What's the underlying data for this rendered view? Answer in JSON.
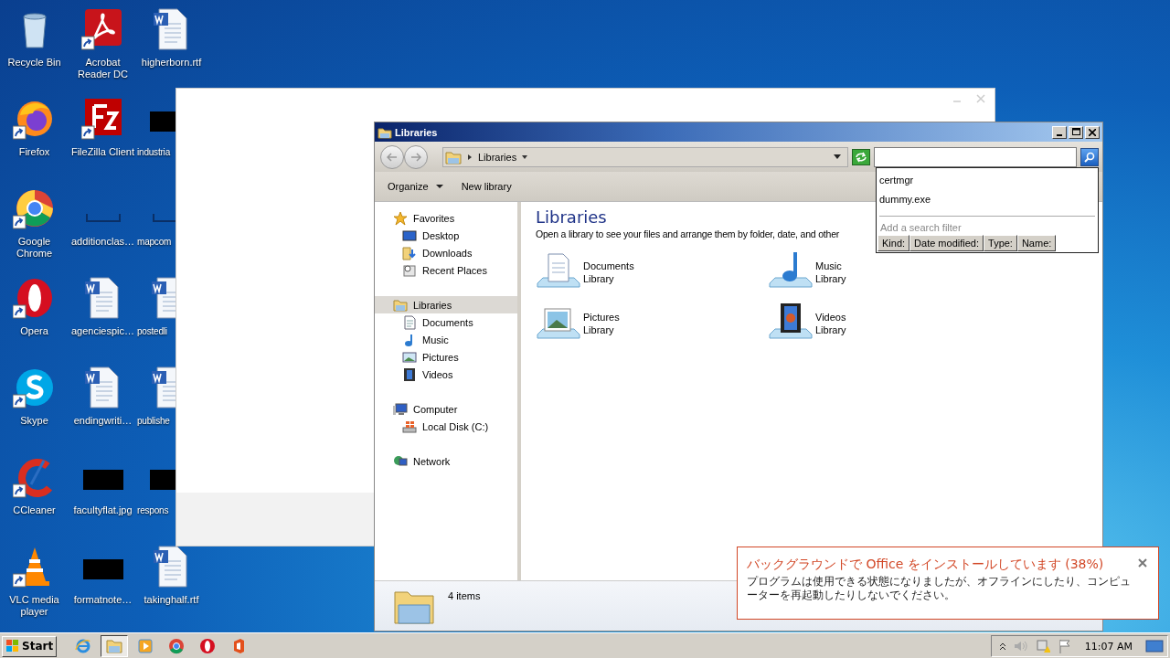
{
  "desktop_icons": [
    {
      "label": "Recycle Bin",
      "kind": "recycle",
      "shortcut": false
    },
    {
      "label": "Acrobat Reader DC",
      "kind": "acrobat",
      "shortcut": true
    },
    {
      "label": "higherborn.rtf",
      "kind": "word",
      "shortcut": false
    },
    {
      "label": "Firefox",
      "kind": "firefox",
      "shortcut": true
    },
    {
      "label": "FileZilla Client",
      "kind": "filezilla",
      "shortcut": true
    },
    {
      "label": "industria",
      "kind": "redacted",
      "shortcut": false
    },
    {
      "label": "Google Chrome",
      "kind": "chrome",
      "shortcut": true
    },
    {
      "label": "additionclas…",
      "kind": "blank",
      "shortcut": false
    },
    {
      "label": "mapcom",
      "kind": "blank",
      "shortcut": false
    },
    {
      "label": "Opera",
      "kind": "opera",
      "shortcut": true
    },
    {
      "label": "agenciespic…",
      "kind": "word",
      "shortcut": false
    },
    {
      "label": "postedli",
      "kind": "word",
      "shortcut": false
    },
    {
      "label": "Skype",
      "kind": "skype",
      "shortcut": true
    },
    {
      "label": "endingwriti…",
      "kind": "word",
      "shortcut": false
    },
    {
      "label": "publishe",
      "kind": "word",
      "shortcut": false
    },
    {
      "label": "CCleaner",
      "kind": "ccleaner",
      "shortcut": true
    },
    {
      "label": "facultyflat.jpg",
      "kind": "redacted",
      "shortcut": false
    },
    {
      "label": "respons",
      "kind": "redacted",
      "shortcut": false
    },
    {
      "label": "VLC media player",
      "kind": "vlc",
      "shortcut": true
    },
    {
      "label": "formatnote…",
      "kind": "redacted",
      "shortcut": false
    },
    {
      "label": "takinghalf.rtf",
      "kind": "word",
      "shortcut": false
    }
  ],
  "explorer": {
    "title": "Libraries",
    "breadcrumb": "Libraries",
    "search_suggestions": [
      "certmgr",
      "dummy.exe"
    ],
    "search_filter_hint": "Add a search filter",
    "search_filters": [
      "Kind:",
      "Date modified:",
      "Type:",
      "Name:"
    ],
    "toolbar": [
      {
        "label": "Organize",
        "kind": "menu"
      },
      {
        "label": "New library",
        "kind": "button"
      }
    ],
    "nav": [
      {
        "label": "Favorites",
        "kind": "star",
        "selected": false,
        "children": [
          {
            "label": "Desktop",
            "kind": "desktop",
            "selected": false
          },
          {
            "label": "Downloads",
            "kind": "downloads",
            "selected": false
          },
          {
            "label": "Recent Places",
            "kind": "recent",
            "selected": false
          }
        ]
      },
      {
        "label": "Libraries",
        "kind": "library",
        "selected": true,
        "children": [
          {
            "label": "Documents",
            "kind": "documents",
            "selected": false
          },
          {
            "label": "Music",
            "kind": "music",
            "selected": false
          },
          {
            "label": "Pictures",
            "kind": "pictures",
            "selected": false
          },
          {
            "label": "Videos",
            "kind": "videos",
            "selected": false
          }
        ]
      },
      {
        "label": "Computer",
        "kind": "computer",
        "selected": false,
        "children": [
          {
            "label": "Local Disk (C:)",
            "kind": "disk",
            "selected": false
          }
        ]
      },
      {
        "label": "Network",
        "kind": "network",
        "selected": false
      }
    ],
    "heading": "Libraries",
    "description": "Open a library to see your files and arrange them by folder, date, and other",
    "libraries": [
      {
        "name": "Documents",
        "type": "Library",
        "kind": "documents"
      },
      {
        "name": "Music",
        "type": "Library",
        "kind": "music"
      },
      {
        "name": "Pictures",
        "type": "Library",
        "kind": "pictures"
      },
      {
        "name": "Videos",
        "type": "Library",
        "kind": "videos"
      }
    ],
    "status": "4 items"
  },
  "notification": {
    "title": "バックグラウンドで Office をインストールしています (38%)",
    "body": "プログラムは使用できる状態になりましたが、オフラインにしたり、コンピューターを再起動したりしないでください。"
  },
  "taskbar": {
    "start": "Start",
    "apps": [
      {
        "kind": "ie",
        "selected": false
      },
      {
        "kind": "explorer",
        "selected": true
      },
      {
        "kind": "media",
        "selected": false
      },
      {
        "kind": "chrome",
        "selected": false
      },
      {
        "kind": "opera",
        "selected": false
      },
      {
        "kind": "office",
        "selected": false
      }
    ],
    "clock": "11:07 AM"
  }
}
